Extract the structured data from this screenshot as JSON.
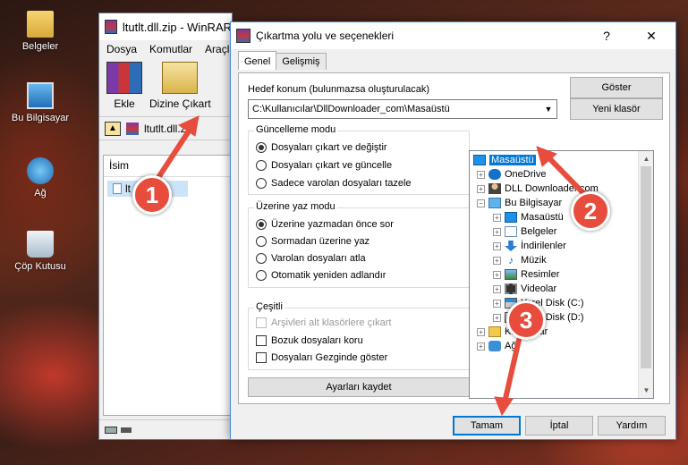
{
  "desktop": {
    "icons": [
      {
        "label": "Belgeler",
        "icon": "documents-folder-icon"
      },
      {
        "label": "Bu Bilgisayar",
        "icon": "computer-icon"
      },
      {
        "label": "Ağ",
        "icon": "network-icon"
      },
      {
        "label": "Çöp Kutusu",
        "icon": "recycle-bin-icon"
      }
    ]
  },
  "winrar": {
    "title": "ltutlt.dll.zip - WinRAR",
    "menu": [
      "Dosya",
      "Komutlar",
      "Araçlar"
    ],
    "toolbar": {
      "add_label": "Ekle",
      "extract_label": "Dizine Çıkart"
    },
    "address": "ltutlt.dll.zip",
    "column_header": "İsim",
    "selected_file": "lt"
  },
  "dialog": {
    "title": "Çıkartma yolu ve seçenekleri",
    "help_glyph": "?",
    "close_glyph": "✕",
    "tabs": [
      "Genel",
      "Gelişmiş"
    ],
    "destination_label": "Hedef konum (bulunmazsa oluşturulacak)",
    "destination_value": "C:\\Kullanıcılar\\DllDownloader_com\\Masaüstü",
    "show_button": "Göster",
    "new_folder_button": "Yeni klasör",
    "update_mode": {
      "title": "Güncelleme modu",
      "options": [
        "Dosyaları çıkart ve değiştir",
        "Dosyaları çıkart ve güncelle",
        "Sadece varolan dosyaları tazele"
      ],
      "selected": 0
    },
    "overwrite_mode": {
      "title": "Üzerine yaz modu",
      "options": [
        "Üzerine yazmadan önce sor",
        "Sormadan üzerine yaz",
        "Varolan dosyaları atla",
        "Otomatik yeniden adlandır"
      ],
      "selected": 0
    },
    "misc": {
      "title": "Çeşitli",
      "options": [
        {
          "label": "Arşivleri alt klasörlere çıkart",
          "checked": false,
          "disabled": true
        },
        {
          "label": "Bozuk dosyaları koru",
          "checked": false,
          "disabled": false
        },
        {
          "label": "Dosyaları Gezginde göster",
          "checked": false,
          "disabled": false
        }
      ]
    },
    "save_settings_button": "Ayarları kaydet",
    "tree": [
      {
        "label": "Masaüstü",
        "icon": "desktop-icon",
        "selected": true
      },
      {
        "label": "OneDrive",
        "icon": "onedrive-icon"
      },
      {
        "label": "DLL Downloader.com",
        "icon": "user-icon"
      },
      {
        "label": "Bu Bilgisayar",
        "icon": "computer-icon"
      },
      {
        "label": "Masaüstü",
        "icon": "desktop-icon"
      },
      {
        "label": "Belgeler",
        "icon": "documents-icon"
      },
      {
        "label": "İndirilenler",
        "icon": "downloads-icon"
      },
      {
        "label": "Müzik",
        "icon": "music-icon"
      },
      {
        "label": "Resimler",
        "icon": "pictures-icon"
      },
      {
        "label": "Videolar",
        "icon": "videos-icon"
      },
      {
        "label": "Yerel Disk (C:)",
        "icon": "drive-icon"
      },
      {
        "label": "Yerel Disk (D:)",
        "icon": "drive-icon"
      },
      {
        "label": "Kitaplıklar",
        "icon": "libraries-icon"
      },
      {
        "label": "Ağ",
        "icon": "network-icon"
      }
    ],
    "ok_button": "Tamam",
    "cancel_button": "İptal",
    "help_button": "Yardım"
  },
  "callouts": [
    "1",
    "2",
    "3"
  ],
  "colors": {
    "accent": "#0078d7",
    "callout": "#e84c3d"
  }
}
